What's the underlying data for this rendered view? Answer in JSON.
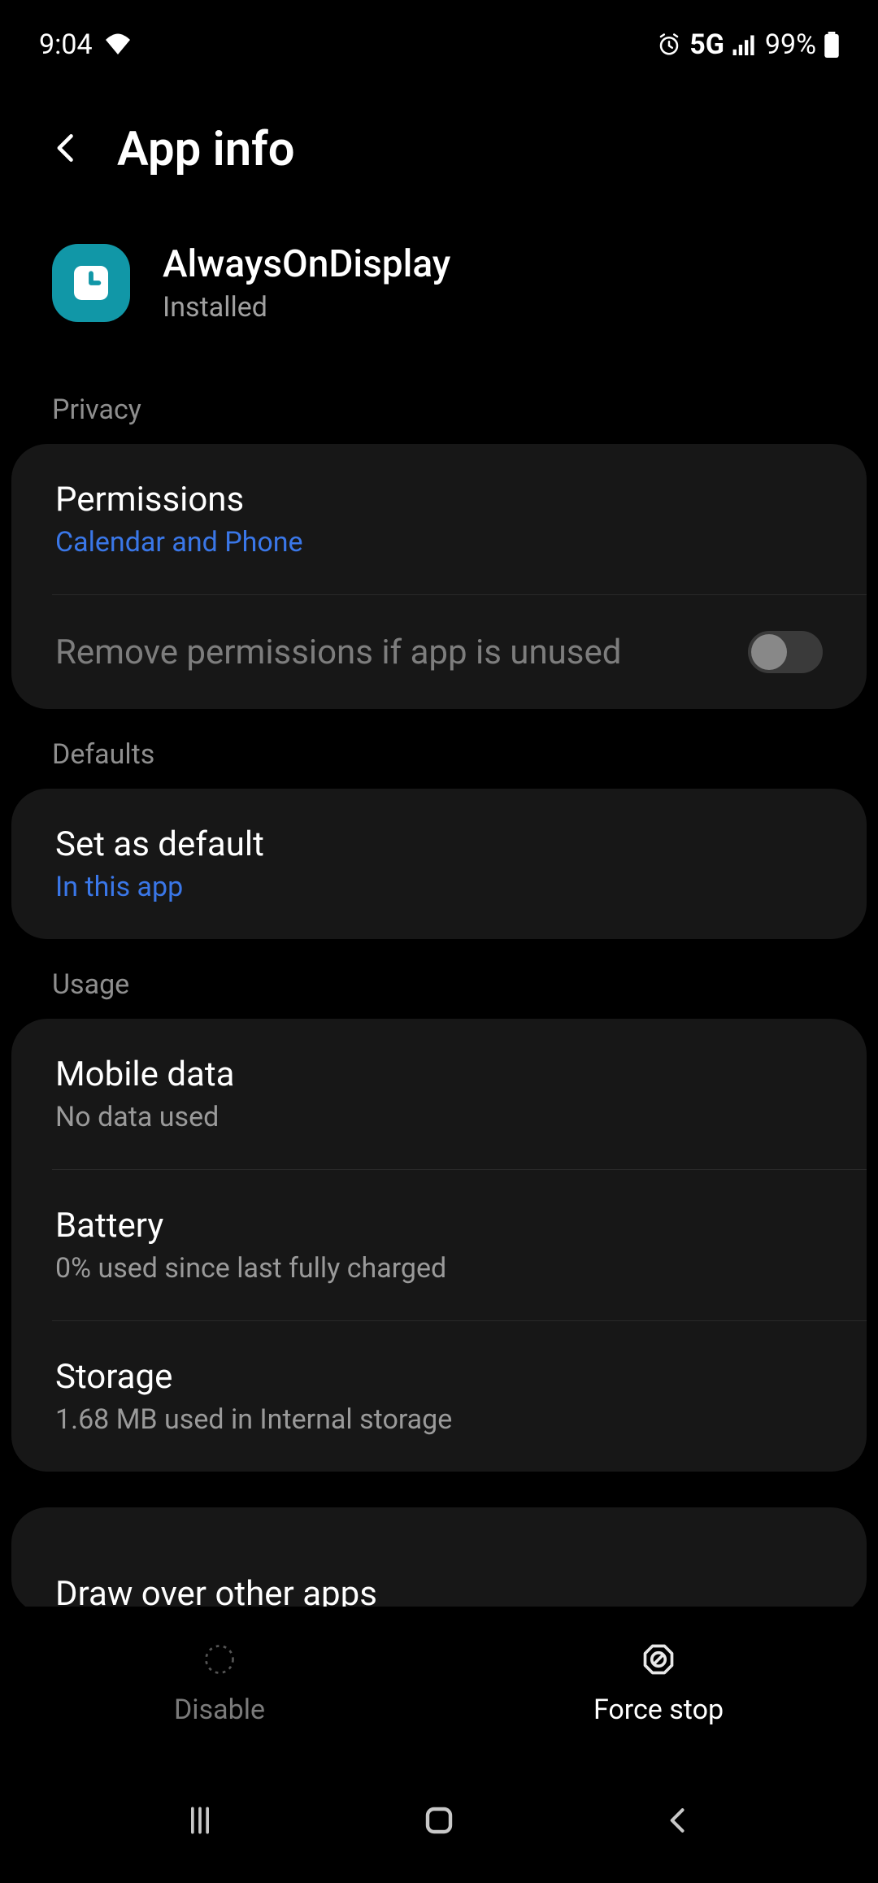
{
  "statusbar": {
    "time": "9:04",
    "network": "5G",
    "battery": "99%"
  },
  "header": {
    "title": "App info"
  },
  "app": {
    "name": "AlwaysOnDisplay",
    "status": "Installed"
  },
  "sections": {
    "privacy": {
      "header": "Privacy",
      "permissions": {
        "title": "Permissions",
        "subtitle": "Calendar and Phone"
      },
      "remove_unused": {
        "title": "Remove permissions if app is unused",
        "enabled": false
      }
    },
    "defaults": {
      "header": "Defaults",
      "set_default": {
        "title": "Set as default",
        "subtitle": "In this app"
      }
    },
    "usage": {
      "header": "Usage",
      "mobile_data": {
        "title": "Mobile data",
        "subtitle": "No data used"
      },
      "battery": {
        "title": "Battery",
        "subtitle": "0% used since last fully charged"
      },
      "storage": {
        "title": "Storage",
        "subtitle": "1.68 MB used in Internal storage"
      }
    },
    "next": {
      "draw_over": {
        "title": "Draw over other apps"
      }
    }
  },
  "actions": {
    "disable": "Disable",
    "force_stop": "Force stop"
  }
}
